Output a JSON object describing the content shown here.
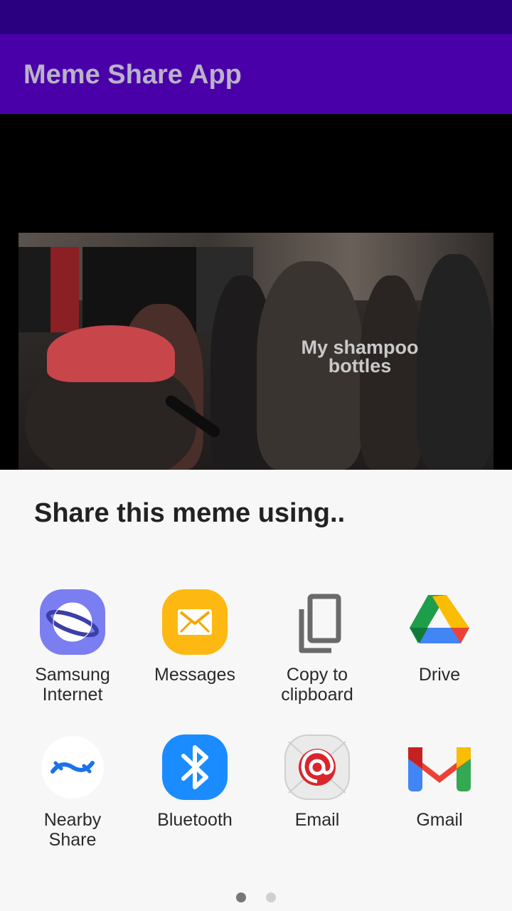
{
  "app": {
    "title": "Meme Share App"
  },
  "meme": {
    "caption_line1": "My shampoo",
    "caption_line2": "bottles"
  },
  "share_sheet": {
    "title": "Share this meme using..",
    "targets": [
      {
        "label_line1": "Samsung",
        "label_line2": "Internet",
        "icon": "samsung-internet-icon"
      },
      {
        "label_line1": "Messages",
        "label_line2": "",
        "icon": "messages-icon"
      },
      {
        "label_line1": "Copy to",
        "label_line2": "clipboard",
        "icon": "copy-icon"
      },
      {
        "label_line1": "Drive",
        "label_line2": "",
        "icon": "drive-icon"
      },
      {
        "label_line1": "Nearby",
        "label_line2": "Share",
        "icon": "nearby-share-icon"
      },
      {
        "label_line1": "Bluetooth",
        "label_line2": "",
        "icon": "bluetooth-icon"
      },
      {
        "label_line1": "Email",
        "label_line2": "",
        "icon": "email-icon"
      },
      {
        "label_line1": "Gmail",
        "label_line2": "",
        "icon": "gmail-icon"
      }
    ],
    "pages": 2,
    "current_page": 1
  },
  "colors": {
    "status_bar": "#2b0080",
    "app_bar": "#4a00a8",
    "sheet": "#f7f7f7"
  }
}
